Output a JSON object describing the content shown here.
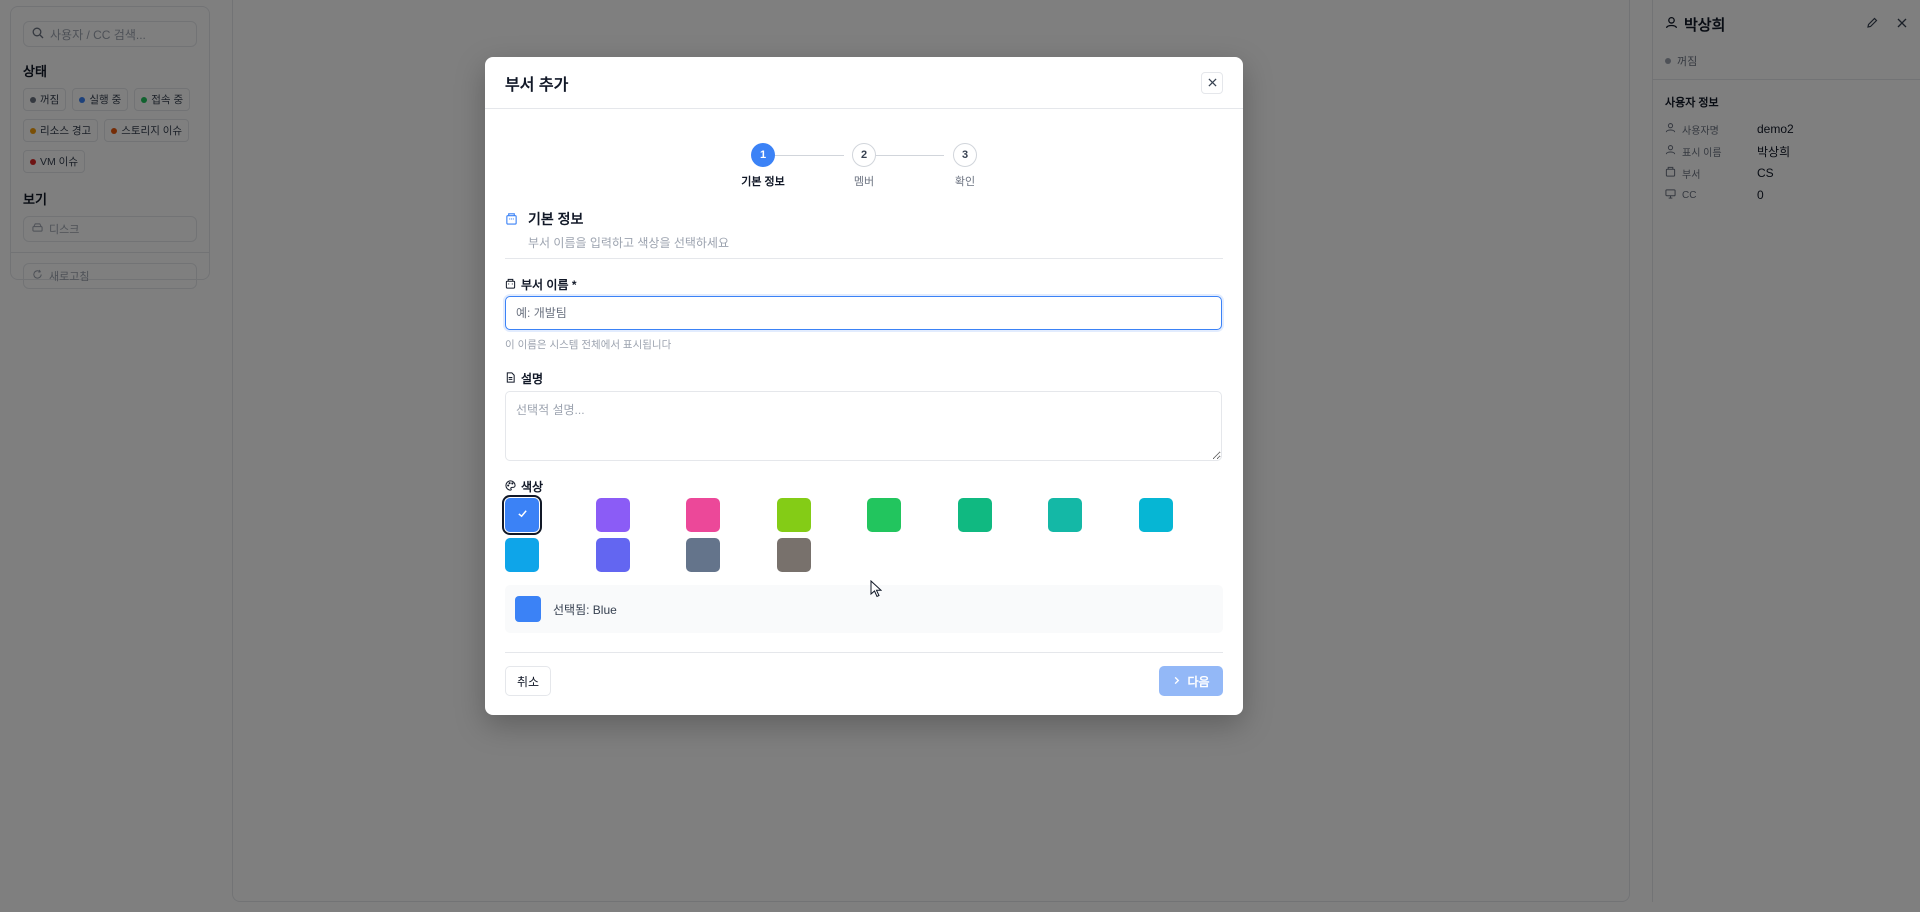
{
  "left_panel": {
    "search_placeholder": "사용자 / CC 검색...",
    "status_title": "상태",
    "status_chips": [
      {
        "label": "꺼짐",
        "color": "#6b7280"
      },
      {
        "label": "실행 중",
        "color": "#3b82f6"
      },
      {
        "label": "접속 중",
        "color": "#22c55e"
      },
      {
        "label": "리소스 경고",
        "color": "#f59e0b"
      },
      {
        "label": "스토리지 이슈",
        "color": "#ea580c"
      },
      {
        "label": "VM 이슈",
        "color": "#dc2626"
      }
    ],
    "view_title": "보기",
    "disk_label": "디스크",
    "refresh_label": "새로고침"
  },
  "right_panel": {
    "user_name": "박상희",
    "status": "꺼짐",
    "section_title": "사용자 정보",
    "fields": [
      {
        "label": "사용자명",
        "value": "demo2"
      },
      {
        "label": "표시 이름",
        "value": "박상희"
      },
      {
        "label": "부서",
        "value": "CS"
      },
      {
        "label": "CC",
        "value": "0"
      }
    ]
  },
  "modal": {
    "title": "부서 추가",
    "steps": [
      {
        "number": "1",
        "label": "기본 정보",
        "active": true
      },
      {
        "number": "2",
        "label": "멤버",
        "active": false
      },
      {
        "number": "3",
        "label": "확인",
        "active": false
      }
    ],
    "section_title": "기본 정보",
    "section_subtitle": "부서 이름을 입력하고 색상을 선택하세요",
    "name_label": "부서 이름 *",
    "name_placeholder": "예: 개발팀",
    "name_value": "",
    "name_hint": "이 이름은 시스템 전체에서 표시됩니다",
    "desc_label": "설명",
    "desc_placeholder": "선택적 설명...",
    "color_label": "색상",
    "colors": [
      "#3b82f6",
      "#8b5cf6",
      "#ec4899",
      "#84cc16",
      "#22c55e",
      "#10b981",
      "#14b8a6",
      "#06b6d4",
      "#0ea5e9",
      "#6366f1",
      "#64748b",
      "#78716c"
    ],
    "selected_color_index": 0,
    "selected_text": "선택됨: Blue",
    "cancel_label": "취소",
    "next_label": "다음"
  }
}
